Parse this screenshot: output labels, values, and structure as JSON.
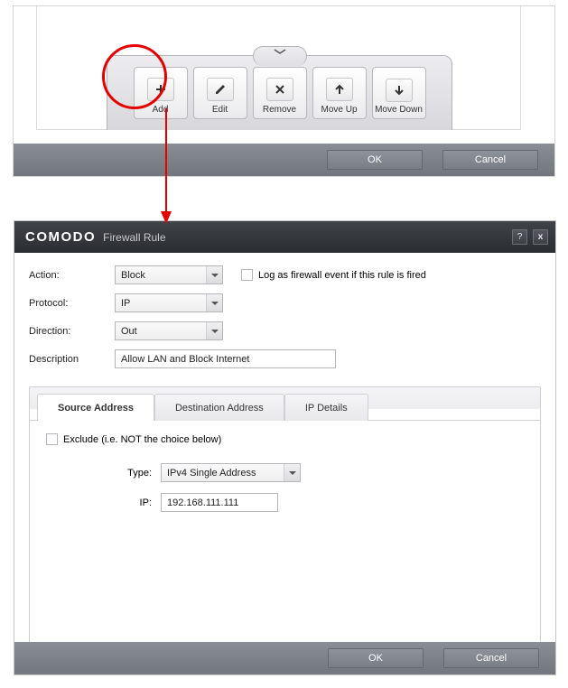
{
  "toolbar": {
    "buttons": {
      "add": "Add",
      "edit": "Edit",
      "remove": "Remove",
      "moveup": "Move Up",
      "movedown": "Move Down"
    },
    "ok": "OK",
    "cancel": "Cancel"
  },
  "dialog": {
    "brand": "COMODO",
    "subtitle": "Firewall Rule",
    "help": "?",
    "close": "x",
    "labels": {
      "action": "Action:",
      "protocol": "Protocol:",
      "direction": "Direction:",
      "description": "Description"
    },
    "values": {
      "action": "Block",
      "protocol": "IP",
      "direction": "Out",
      "description": "Allow LAN and Block Internet"
    },
    "log_label": "Log as firewall event if this rule is fired",
    "tabs": {
      "source": "Source Address",
      "dest": "Destination Address",
      "ip": "IP Details"
    },
    "source": {
      "exclude": "Exclude (i.e. NOT the choice below)",
      "type_label": "Type:",
      "type_value": "IPv4 Single Address",
      "ip_label": "IP:",
      "ip_value": "192.168.111.111"
    },
    "ok": "OK",
    "cancel": "Cancel"
  }
}
